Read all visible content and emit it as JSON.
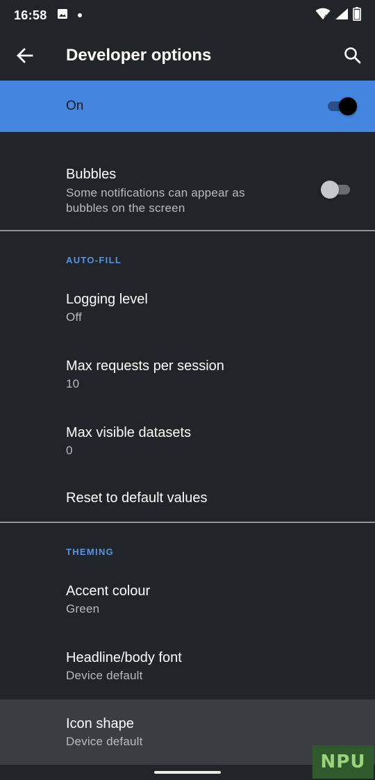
{
  "status_bar": {
    "time": "16:58",
    "icons": [
      "image-icon",
      "notification-dot",
      "wifi-icon",
      "signal-icon",
      "battery-icon"
    ]
  },
  "app_bar": {
    "title": "Developer options",
    "back_icon": "arrow-back-icon",
    "search_icon": "search-icon"
  },
  "master_switch": {
    "label": "On",
    "checked": true
  },
  "bubbles": {
    "title": "Bubbles",
    "summary_line1": "Some notifications can appear as",
    "summary_line2": "bubbles on the screen",
    "checked": false
  },
  "autofill": {
    "header": "AUTO-FILL",
    "items": [
      {
        "title": "Logging level",
        "summary": "Off"
      },
      {
        "title": "Max requests per session",
        "summary": "10"
      },
      {
        "title": "Max visible datasets",
        "summary": "0"
      },
      {
        "title": "Reset to default values"
      }
    ]
  },
  "theming": {
    "header": "THEMING",
    "items": [
      {
        "title": "Accent colour",
        "summary": "Green"
      },
      {
        "title": "Headline/body font",
        "summary": "Device default"
      },
      {
        "title": "Icon shape",
        "summary": "Device default"
      }
    ]
  },
  "watermark": {
    "text": "NPU"
  },
  "colors": {
    "background": "#212529",
    "accent": "#4485e0",
    "category": "#5b94e0",
    "summary_text": "#b7bcc2",
    "highlight_row": "#3a3e43"
  }
}
